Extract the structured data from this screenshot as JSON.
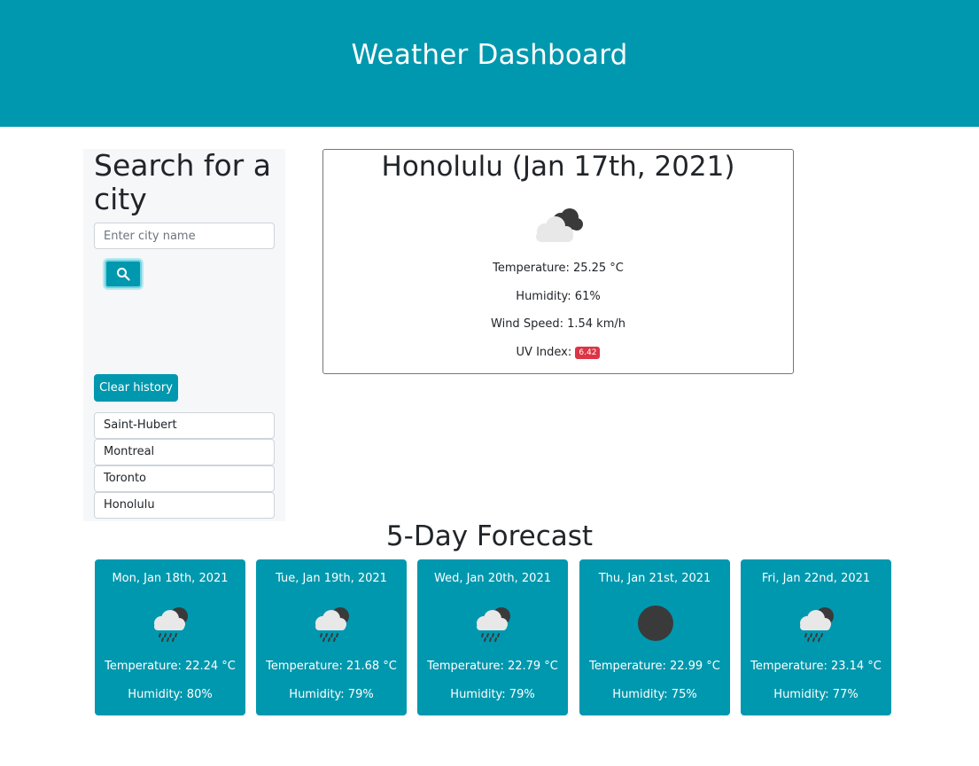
{
  "header": {
    "title": "Weather Dashboard"
  },
  "sidebar": {
    "heading": "Search for a city",
    "search_placeholder": "Enter city name",
    "clear_label": "Clear history",
    "history": [
      "Saint-Hubert",
      "Montreal",
      "Toronto",
      "Honolulu"
    ]
  },
  "current": {
    "title": "Honolulu (Jan 17th, 2021)",
    "icon": "cloudy-icon",
    "temperature": "Temperature: 25.25 °C",
    "humidity": "Humidity: 61%",
    "wind": "Wind Speed: 1.54 km/h",
    "uv_label": "UV Index:",
    "uv_value": "6.42"
  },
  "forecast": {
    "title": "5-Day Forecast",
    "days": [
      {
        "date": "Mon, Jan 18th, 2021",
        "icon": "rain-icon",
        "temp": "Temperature: 22.24 °C",
        "hum": "Humidity: 80%"
      },
      {
        "date": "Tue, Jan 19th, 2021",
        "icon": "rain-icon",
        "temp": "Temperature: 21.68 °C",
        "hum": "Humidity: 79%"
      },
      {
        "date": "Wed, Jan 20th, 2021",
        "icon": "rain-icon",
        "temp": "Temperature: 22.79 °C",
        "hum": "Humidity: 79%"
      },
      {
        "date": "Thu, Jan 21st, 2021",
        "icon": "clear-night-icon",
        "temp": "Temperature: 22.99 °C",
        "hum": "Humidity: 75%"
      },
      {
        "date": "Fri, Jan 22nd, 2021",
        "icon": "rain-icon",
        "temp": "Temperature: 23.14 °C",
        "hum": "Humidity: 77%"
      }
    ]
  },
  "colors": {
    "accent": "#0098ae",
    "uv_badge": "#dc3545"
  }
}
